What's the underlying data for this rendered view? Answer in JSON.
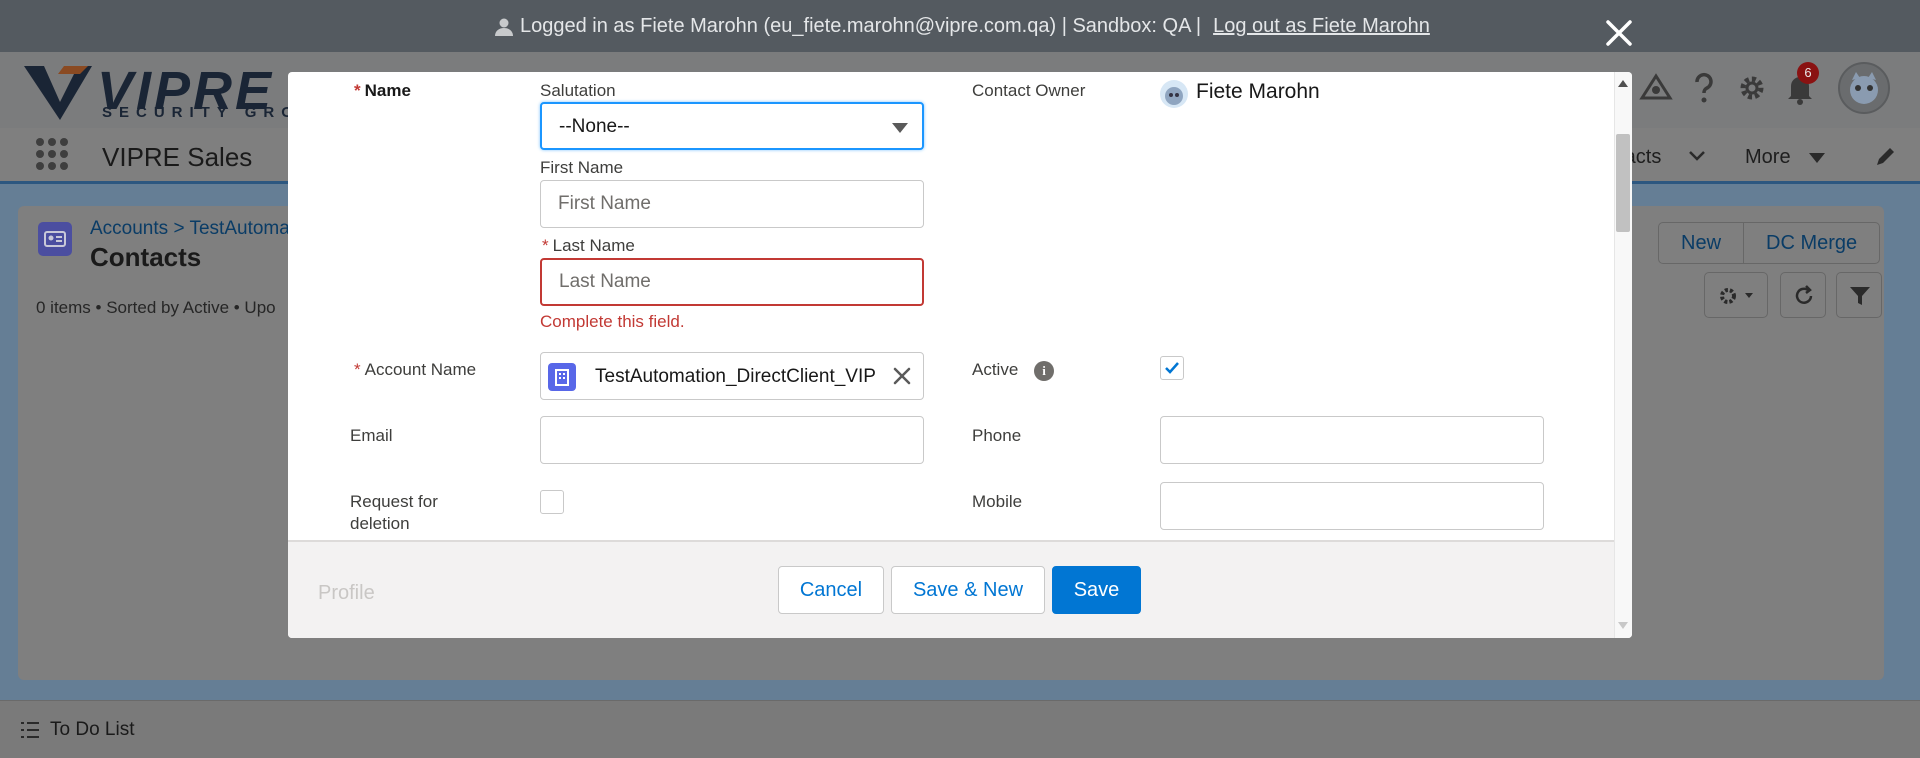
{
  "topbar": {
    "login_text": "Logged in as Fiete Marohn (eu_fiete.marohn@vipre.com.qa) | Sandbox: QA |",
    "logout_link": "Log out as Fiete Marohn"
  },
  "brand": {
    "logo_text": "VIPRE",
    "logo_subtext": "SECURITY GROUP",
    "notification_count": "6"
  },
  "nav": {
    "app_name": "VIPRE Sales",
    "tab_contracts": "racts",
    "tab_more": "More"
  },
  "page": {
    "breadcrumb_accounts": "Accounts",
    "breadcrumb_sep": ">",
    "breadcrumb_account": "TestAutoma",
    "title": "Contacts",
    "meta": "0 items • Sorted by Active • Upo",
    "buttons": [
      "New",
      "DC Merge"
    ]
  },
  "todo": {
    "label": "To Do List"
  },
  "form": {
    "name_label": "Name",
    "salutation_label": "Salutation",
    "salutation_value": "--None--",
    "first_name_label": "First Name",
    "first_name_placeholder": "First Name",
    "last_name_label": "Last Name",
    "last_name_placeholder": "Last Name",
    "last_name_error": "Complete this field.",
    "account_name_label": "Account Name",
    "account_name_value": "TestAutomation_DirectClient_VIP",
    "email_label": "Email",
    "request_deletion_label_1": "Request for",
    "request_deletion_label_2": "deletion",
    "contact_owner_label": "Contact Owner",
    "contact_owner_value": "Fiete Marohn",
    "active_label": "Active",
    "active_checked": true,
    "phone_label": "Phone",
    "mobile_label": "Mobile",
    "required_marker": "*"
  },
  "footer": {
    "ghost_text": "Profile",
    "cancel_label": "Cancel",
    "save_new_label": "Save & New",
    "save_label": "Save"
  },
  "colors": {
    "brand_blue": "#0176d3",
    "error_red": "#c23934",
    "focus_blue": "#1b96ff"
  }
}
